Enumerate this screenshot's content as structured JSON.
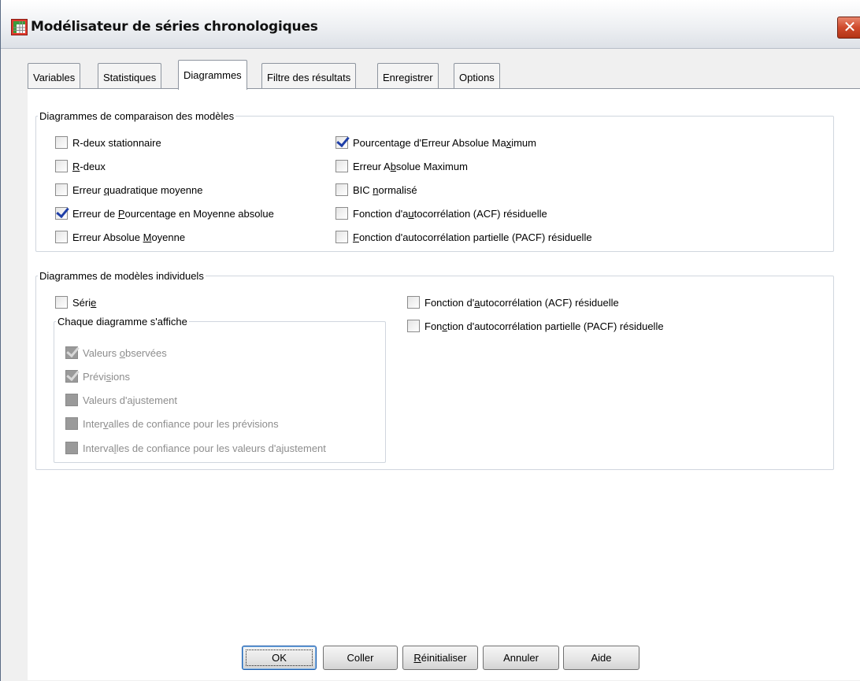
{
  "window": {
    "title": "Modélisateur de séries chronologiques",
    "close_glyph": "✕"
  },
  "tabs": [
    {
      "label": "Variables",
      "active": false
    },
    {
      "label": "Statistiques",
      "active": false
    },
    {
      "label": "Diagrammes",
      "active": true
    },
    {
      "label": "Filtre des résultats",
      "active": false
    },
    {
      "label": "Enregistrer",
      "active": false
    },
    {
      "label": "Options",
      "active": false
    }
  ],
  "comparison": {
    "legend": "Diagrammes de comparaison des modèles",
    "left": [
      {
        "pre": "R-deux stationnaire",
        "u": "",
        "post": "",
        "checked": false
      },
      {
        "pre": "",
        "u": "R",
        "post": "-deux",
        "checked": false
      },
      {
        "pre": "Erreur ",
        "u": "q",
        "post": "uadratique moyenne",
        "checked": false
      },
      {
        "pre": "Erreur de ",
        "u": "P",
        "post": "ourcentage en Moyenne absolue",
        "checked": true
      },
      {
        "pre": "Erreur Absolue ",
        "u": "M",
        "post": "oyenne",
        "checked": false
      }
    ],
    "right": [
      {
        "pre": "Pourcentage d'Erreur Absolue Ma",
        "u": "x",
        "post": "imum",
        "checked": true
      },
      {
        "pre": "Erreur A",
        "u": "b",
        "post": "solue Maximum",
        "checked": false
      },
      {
        "pre": "BIC ",
        "u": "n",
        "post": "ormalisé",
        "checked": false
      },
      {
        "pre": "Fonction d'a",
        "u": "u",
        "post": "tocorrélation (ACF) résiduelle",
        "checked": false
      },
      {
        "pre": "",
        "u": "F",
        "post": "onction d'autocorrélation partielle (PACF) résiduelle",
        "checked": false
      }
    ]
  },
  "individual": {
    "legend": "Diagrammes de modèles individuels",
    "serie": {
      "pre": "Séri",
      "u": "e",
      "post": "",
      "checked": false
    },
    "sub_legend": "Chaque diagramme s'affiche",
    "sub_items": [
      {
        "pre": "Valeurs ",
        "u": "o",
        "post": "bservées",
        "checked": true
      },
      {
        "pre": "Prévi",
        "u": "s",
        "post": "ions",
        "checked": true
      },
      {
        "pre": "Valeurs d'ajustement",
        "u": "",
        "post": "",
        "checked": false
      },
      {
        "pre": "Inter",
        "u": "v",
        "post": "alles de confiance pour les prévisions",
        "checked": false
      },
      {
        "pre": "Interva",
        "u": "l",
        "post": "les de confiance pour les valeurs d'ajustement",
        "checked": false
      }
    ],
    "right": [
      {
        "pre": "Fonction d'",
        "u": "a",
        "post": "utocorrélation (ACF) résiduelle",
        "checked": false
      },
      {
        "pre": "Fon",
        "u": "c",
        "post": "tion d'autocorrélation partielle (PACF) résiduelle",
        "checked": false
      }
    ]
  },
  "buttons": {
    "ok": "OK",
    "paste": "Coller",
    "reset_u": "R",
    "reset_post": "éinitialiser",
    "cancel": "Annuler",
    "help": "Aide"
  },
  "colors": {
    "check": "#1f3fa8",
    "close_button": "#cf4a2c",
    "panel_bg": "#ffffff",
    "window_bg": "#f0f0f0"
  }
}
